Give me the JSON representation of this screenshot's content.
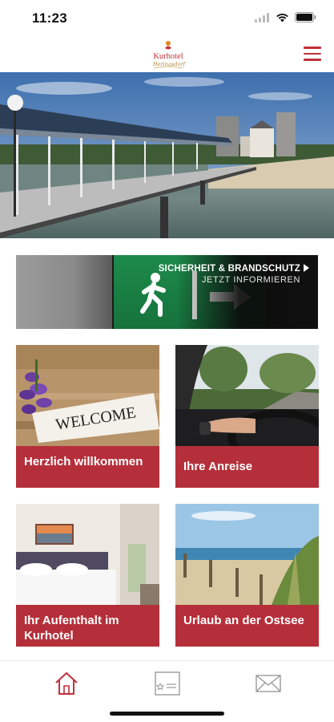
{
  "status_bar": {
    "time": "11:23",
    "icons": [
      "signal-icon",
      "wifi-icon",
      "battery-icon"
    ]
  },
  "header": {
    "logo_text": "Kurhotel",
    "logo_script": "Heringsdorf",
    "menu_icon": "hamburger-icon",
    "accent_color": "#c0303a"
  },
  "hero": {
    "image": "pier-photo"
  },
  "banner": {
    "title": "SICHERHEIT & BRANDSCHUTZ",
    "subtitle": "JETZT INFORMIEREN",
    "icon": "chevron-right-icon"
  },
  "tiles": [
    {
      "label": "Herzlich willkommen",
      "image": "welcome-photo"
    },
    {
      "label": "Ihre Anreise",
      "image": "car-photo"
    },
    {
      "label": "Ihr Aufenthalt im Kurhotel",
      "image": "room-photo"
    },
    {
      "label": "Urlaub an der Ostsee",
      "image": "beach-photo"
    }
  ],
  "tile_color": "#b52f3a",
  "photo_text": {
    "welcome_sign": "WELCOME"
  },
  "tab_bar": {
    "tabs": [
      {
        "name": "home",
        "icon": "home-icon",
        "active": true
      },
      {
        "name": "info",
        "icon": "info-card-icon",
        "active": false
      },
      {
        "name": "mail",
        "icon": "mail-icon",
        "active": false
      }
    ]
  }
}
